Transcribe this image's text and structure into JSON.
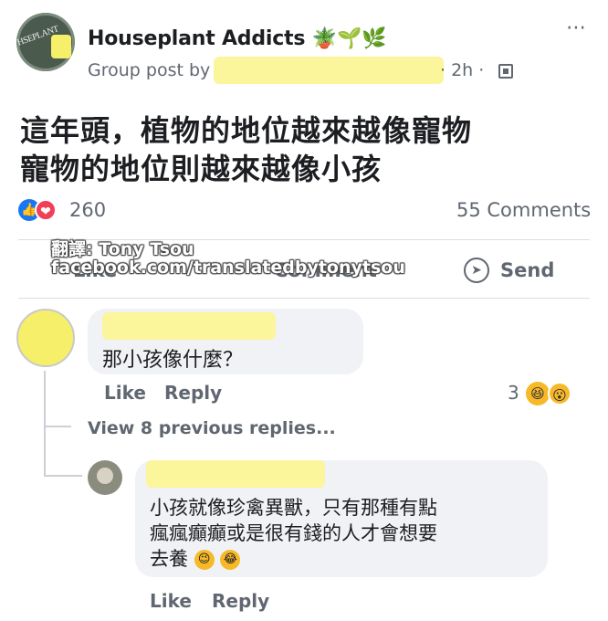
{
  "post": {
    "group_name": "Houseplant Addicts",
    "group_emojis": "🪴🌱🌿",
    "group_avatar_text": "HSEPLANT",
    "subtitle": "Group post by",
    "time": "· 2h ·",
    "line1": "這年頭，植物的地位越來越像寵物",
    "line2": "寵物的地位則越來越像小孩",
    "more_icon": "⋯"
  },
  "stats": {
    "reactions_count": "260",
    "comments_label": "55 Comments",
    "like_icon": "👍",
    "love_icon": "❤"
  },
  "actions": {
    "like": "Like",
    "comment": "Comment",
    "send": "Send",
    "send_icon": "➤"
  },
  "watermark": {
    "line1": "翻譯: Tony Tsou",
    "line2": "facebook.com/translatedbytonytsou"
  },
  "comment1": {
    "text": "那小孩像什麼？",
    "like": "Like",
    "reply": "Reply",
    "reaction_count": "3",
    "reaction_icon1": "😆",
    "reaction_icon2": "😮"
  },
  "view_more": "View 8 previous replies...",
  "comment2": {
    "line1": "小孩就像珍禽異獸，只有那種有點",
    "line2": "瘋瘋癲癲或是很有錢的人才會想要",
    "line3": "去養",
    "emoji1": "😉",
    "emoji2": "😂",
    "like": "Like",
    "reply": "Reply"
  }
}
